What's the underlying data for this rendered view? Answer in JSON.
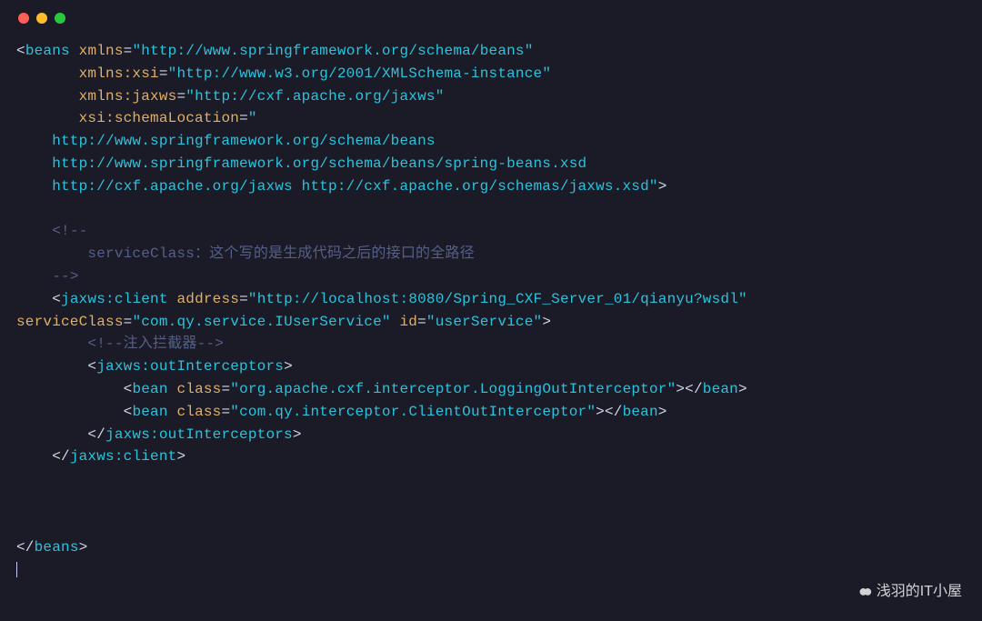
{
  "code": {
    "lines": [
      [
        {
          "cls": "punct",
          "t": "<"
        },
        {
          "cls": "tag",
          "t": "beans"
        },
        {
          "cls": "plain",
          "t": " "
        },
        {
          "cls": "attr",
          "t": "xmlns"
        },
        {
          "cls": "punct",
          "t": "="
        },
        {
          "cls": "string",
          "t": "\"http://www.springframework.org/schema/beans\""
        }
      ],
      [
        {
          "cls": "plain",
          "t": "       "
        },
        {
          "cls": "attr",
          "t": "xmlns:xsi"
        },
        {
          "cls": "punct",
          "t": "="
        },
        {
          "cls": "string",
          "t": "\"http://www.w3.org/2001/XMLSchema-instance\""
        }
      ],
      [
        {
          "cls": "plain",
          "t": "       "
        },
        {
          "cls": "attr",
          "t": "xmlns:jaxws"
        },
        {
          "cls": "punct",
          "t": "="
        },
        {
          "cls": "string",
          "t": "\"http://cxf.apache.org/jaxws\""
        }
      ],
      [
        {
          "cls": "plain",
          "t": "       "
        },
        {
          "cls": "attr",
          "t": "xsi:schemaLocation"
        },
        {
          "cls": "punct",
          "t": "="
        },
        {
          "cls": "string",
          "t": "\""
        }
      ],
      [
        {
          "cls": "string",
          "t": "    http://www.springframework.org/schema/beans"
        }
      ],
      [
        {
          "cls": "string",
          "t": "    http://www.springframework.org/schema/beans/spring-beans.xsd"
        }
      ],
      [
        {
          "cls": "string",
          "t": "    http://cxf.apache.org/jaxws http://cxf.apache.org/schemas/jaxws.xsd\""
        },
        {
          "cls": "punct",
          "t": ">"
        }
      ],
      [
        {
          "cls": "plain",
          "t": ""
        }
      ],
      [
        {
          "cls": "plain",
          "t": "    "
        },
        {
          "cls": "comment",
          "t": "<!--"
        }
      ],
      [
        {
          "cls": "comment",
          "t": "        serviceClass：这个写的是生成代码之后的接口的全路径"
        }
      ],
      [
        {
          "cls": "plain",
          "t": "    "
        },
        {
          "cls": "comment",
          "t": "-->"
        }
      ],
      [
        {
          "cls": "plain",
          "t": "    "
        },
        {
          "cls": "punct",
          "t": "<"
        },
        {
          "cls": "tag",
          "t": "jaxws:client"
        },
        {
          "cls": "plain",
          "t": " "
        },
        {
          "cls": "attr",
          "t": "address"
        },
        {
          "cls": "punct",
          "t": "="
        },
        {
          "cls": "string",
          "t": "\"http://localhost:8080/Spring_CXF_Server_01/qianyu?wsdl\""
        },
        {
          "cls": "plain",
          "t": " "
        }
      ],
      [
        {
          "cls": "attr",
          "t": "serviceClass"
        },
        {
          "cls": "punct",
          "t": "="
        },
        {
          "cls": "string",
          "t": "\"com.qy.service.IUserService\""
        },
        {
          "cls": "plain",
          "t": " "
        },
        {
          "cls": "attr",
          "t": "id"
        },
        {
          "cls": "punct",
          "t": "="
        },
        {
          "cls": "string",
          "t": "\"userService\""
        },
        {
          "cls": "punct",
          "t": ">"
        }
      ],
      [
        {
          "cls": "plain",
          "t": "        "
        },
        {
          "cls": "comment",
          "t": "<!--注入拦截器-->"
        }
      ],
      [
        {
          "cls": "plain",
          "t": "        "
        },
        {
          "cls": "punct",
          "t": "<"
        },
        {
          "cls": "tag",
          "t": "jaxws:outInterceptors"
        },
        {
          "cls": "punct",
          "t": ">"
        }
      ],
      [
        {
          "cls": "plain",
          "t": "            "
        },
        {
          "cls": "punct",
          "t": "<"
        },
        {
          "cls": "tag",
          "t": "bean"
        },
        {
          "cls": "plain",
          "t": " "
        },
        {
          "cls": "attr",
          "t": "class"
        },
        {
          "cls": "punct",
          "t": "="
        },
        {
          "cls": "string",
          "t": "\"org.apache.cxf.interceptor.LoggingOutInterceptor\""
        },
        {
          "cls": "punct",
          "t": "></"
        },
        {
          "cls": "tag",
          "t": "bean"
        },
        {
          "cls": "punct",
          "t": ">"
        }
      ],
      [
        {
          "cls": "plain",
          "t": "            "
        },
        {
          "cls": "punct",
          "t": "<"
        },
        {
          "cls": "tag",
          "t": "bean"
        },
        {
          "cls": "plain",
          "t": " "
        },
        {
          "cls": "attr",
          "t": "class"
        },
        {
          "cls": "punct",
          "t": "="
        },
        {
          "cls": "string",
          "t": "\"com.qy.interceptor.ClientOutInterceptor\""
        },
        {
          "cls": "punct",
          "t": "></"
        },
        {
          "cls": "tag",
          "t": "bean"
        },
        {
          "cls": "punct",
          "t": ">"
        }
      ],
      [
        {
          "cls": "plain",
          "t": "        "
        },
        {
          "cls": "punct",
          "t": "</"
        },
        {
          "cls": "tag",
          "t": "jaxws:outInterceptors"
        },
        {
          "cls": "punct",
          "t": ">"
        }
      ],
      [
        {
          "cls": "plain",
          "t": "    "
        },
        {
          "cls": "punct",
          "t": "</"
        },
        {
          "cls": "tag",
          "t": "jaxws:client"
        },
        {
          "cls": "punct",
          "t": ">"
        }
      ],
      [
        {
          "cls": "plain",
          "t": ""
        }
      ],
      [
        {
          "cls": "plain",
          "t": ""
        }
      ],
      [
        {
          "cls": "plain",
          "t": ""
        }
      ],
      [
        {
          "cls": "punct",
          "t": "</"
        },
        {
          "cls": "tag",
          "t": "beans"
        },
        {
          "cls": "punct",
          "t": ">"
        }
      ]
    ]
  },
  "watermark": {
    "text": "浅羽的IT小屋"
  }
}
